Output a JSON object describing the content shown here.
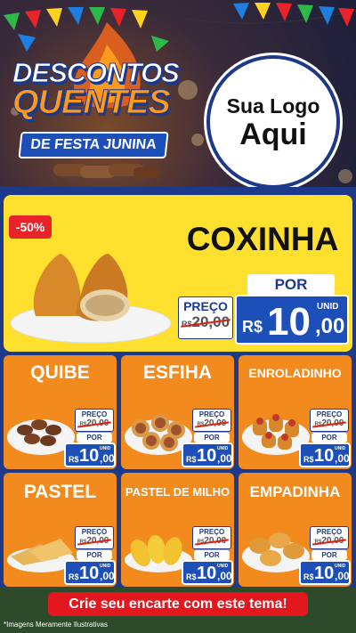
{
  "header": {
    "title_line1": "DESCONTOS",
    "title_line2": "QUENTES",
    "title_line3": "DE FESTA JUNINA",
    "logo_line1": "Sua Logo",
    "logo_line2": "Aqui"
  },
  "hero": {
    "discount_badge": "-50%",
    "name": "COXINHA",
    "preco_label": "PREÇO",
    "old_price_currency": "R$",
    "old_price": "20,00",
    "por_label": "POR",
    "unit_label": "UNID",
    "new_price_currency": "R$",
    "new_price_int": "10",
    "new_price_dec": ",00"
  },
  "products": [
    {
      "name": "QUIBE",
      "preco_label": "PREÇO",
      "old_currency": "R$",
      "old_price": "20,00",
      "por_label": "POR",
      "unit_label": "UNID",
      "currency": "R$",
      "price_int": "10",
      "price_dec": ",00"
    },
    {
      "name": "ESFIHA",
      "preco_label": "PREÇO",
      "old_currency": "R$",
      "old_price": "20,00",
      "por_label": "POR",
      "unit_label": "UNID",
      "currency": "R$",
      "price_int": "10",
      "price_dec": ",00"
    },
    {
      "name": "ENROLADINHO",
      "preco_label": "PREÇO",
      "old_currency": "R$",
      "old_price": "20,00",
      "por_label": "POR",
      "unit_label": "UNID",
      "currency": "R$",
      "price_int": "10",
      "price_dec": ",00"
    },
    {
      "name": "PASTEL",
      "preco_label": "PREÇO",
      "old_currency": "R$",
      "old_price": "20,00",
      "por_label": "POR",
      "unit_label": "UNID",
      "currency": "R$",
      "price_int": "10",
      "price_dec": ",00"
    },
    {
      "name": "PASTEL DE MILHO",
      "preco_label": "PREÇO",
      "old_currency": "R$",
      "old_price": "20,00",
      "por_label": "POR",
      "unit_label": "UNID",
      "currency": "R$",
      "price_int": "10",
      "price_dec": ",00"
    },
    {
      "name": "EMPADINHA",
      "preco_label": "PREÇO",
      "old_currency": "R$",
      "old_price": "20,00",
      "por_label": "POR",
      "unit_label": "UNID",
      "currency": "R$",
      "price_int": "10",
      "price_dec": ",00"
    }
  ],
  "footer": {
    "cta": "Crie seu encarte com este tema!",
    "disclaimer": "*Imagens Meramente Ilustrativas"
  },
  "colors": {
    "background_blue": "#1d3a8a",
    "hero_yellow": "#ffe02e",
    "card_orange": "#f28a1e",
    "price_blue": "#1d4fb8",
    "badge_red": "#e8232a",
    "cta_red": "#e3171d"
  }
}
